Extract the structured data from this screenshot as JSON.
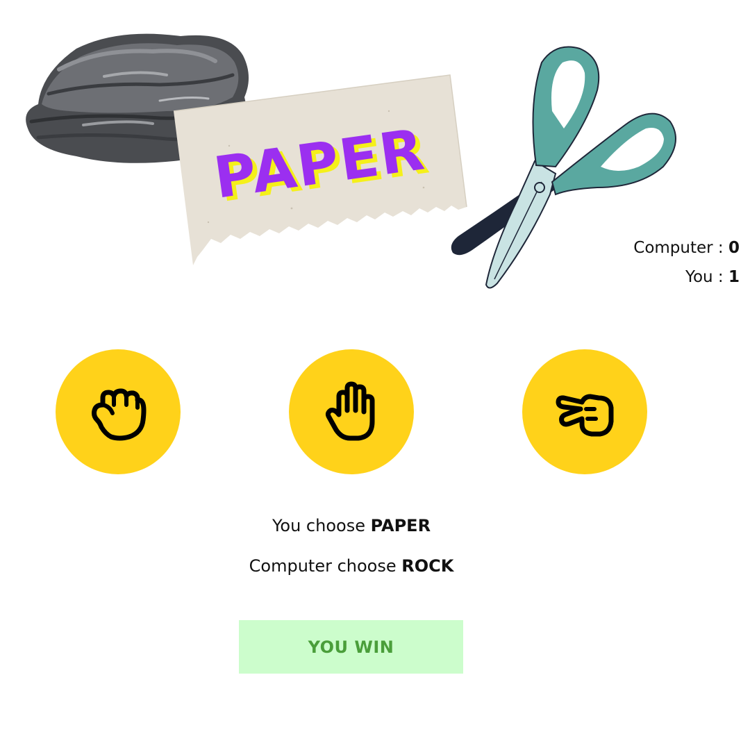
{
  "hero": {
    "paper_label": "PAPER",
    "paper_label_color": "#9b2ff0",
    "paper_shadow_color": "#f5f01a"
  },
  "score": {
    "computer_label": "Computer :",
    "computer_value": "0",
    "you_label": "You :",
    "you_value": "1"
  },
  "choices": [
    {
      "name": "rock",
      "icon": "fist-icon"
    },
    {
      "name": "paper",
      "icon": "open-hand-icon"
    },
    {
      "name": "scissors",
      "icon": "two-fingers-icon"
    }
  ],
  "result": {
    "you_prefix": "You choose",
    "you_choice": "PAPER",
    "computer_prefix": "Computer choose",
    "computer_choice": "ROCK"
  },
  "verdict": {
    "text": "YOU WIN",
    "text_color": "#4a9e3a",
    "background": "#ccfdcc"
  },
  "colors": {
    "button_yellow": "#ffd21a",
    "scissors_handle": "#5aa8a0",
    "scissors_blade_light": "#c9e3e3",
    "scissors_blade_dark": "#1e2638",
    "rock_gray": "#5a5c60"
  }
}
